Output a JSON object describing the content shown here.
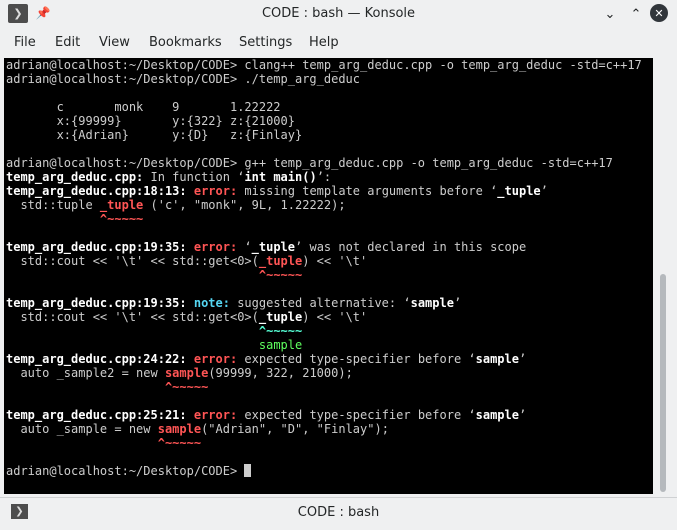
{
  "window": {
    "title": "CODE : bash — Konsole",
    "app_menu_icon": "terminal-icon",
    "pin_icon": "pin-icon",
    "buttons": {
      "minimize": "⌄",
      "maximize": "⌃",
      "close": "✕"
    }
  },
  "menubar": [
    "File",
    "Edit",
    "View",
    "Bookmarks",
    "Settings",
    "Help"
  ],
  "terminal": {
    "cursor_visible": true,
    "lines": [
      [
        {
          "t": "adrian@localhost:~/Desktop/CODE> clang++ temp_arg_deduc.cpp -o temp_arg_deduc -std=c++17"
        }
      ],
      [
        {
          "t": "adrian@localhost:~/Desktop/CODE> ./temp_arg_deduc"
        }
      ],
      [
        {
          "t": ""
        }
      ],
      [
        {
          "t": "       c       monk    9       1.22222"
        }
      ],
      [
        {
          "t": "       x:{99999}       y:{322} z:{21000}"
        }
      ],
      [
        {
          "t": "       x:{Adrian}      y:{D}   z:{Finlay}"
        }
      ],
      [
        {
          "t": ""
        }
      ],
      [
        {
          "t": "adrian@localhost:~/Desktop/CODE> g++ temp_arg_deduc.cpp -o temp_arg_deduc -std=c++17"
        }
      ],
      [
        {
          "t": "temp_arg_deduc.cpp:",
          "c": "b"
        },
        {
          "t": " In function "
        },
        {
          "t": "‘"
        },
        {
          "t": "int main()",
          "c": "b"
        },
        {
          "t": "’:"
        }
      ],
      [
        {
          "t": "temp_arg_deduc.cpp:18:13: ",
          "c": "b"
        },
        {
          "t": "error:",
          "c": "err"
        },
        {
          "t": " missing template arguments before ‘"
        },
        {
          "t": "_tuple",
          "c": "b"
        },
        {
          "t": "’"
        }
      ],
      [
        {
          "t": "  std::tuple "
        },
        {
          "t": "_tuple",
          "c": "hl-red"
        },
        {
          "t": " ('c', \"monk\", 9L, 1.22222);"
        }
      ],
      [
        {
          "t": "             "
        },
        {
          "t": "^~~~~~",
          "c": "caret-red"
        }
      ],
      [
        {
          "t": ""
        }
      ],
      [
        {
          "t": "temp_arg_deduc.cpp:19:35: ",
          "c": "b"
        },
        {
          "t": "error:",
          "c": "err"
        },
        {
          "t": " ‘"
        },
        {
          "t": "_tuple",
          "c": "b"
        },
        {
          "t": "’ was not declared in this scope"
        }
      ],
      [
        {
          "t": "  std::cout << '\\t' << std::get<0>("
        },
        {
          "t": "_tuple",
          "c": "hl-red"
        },
        {
          "t": ") << '\\t'"
        }
      ],
      [
        {
          "t": "                                   "
        },
        {
          "t": "^~~~~~",
          "c": "caret-red"
        }
      ],
      [
        {
          "t": ""
        }
      ],
      [
        {
          "t": "temp_arg_deduc.cpp:19:35: ",
          "c": "b"
        },
        {
          "t": "note:",
          "c": "note"
        },
        {
          "t": " suggested alternative: ‘"
        },
        {
          "t": "sample",
          "c": "b"
        },
        {
          "t": "’"
        }
      ],
      [
        {
          "t": "  std::cout << '\\t' << std::get<0>("
        },
        {
          "t": "_tuple",
          "c": "b"
        },
        {
          "t": ") << '\\t'"
        }
      ],
      [
        {
          "t": "                                   "
        },
        {
          "t": "^~~~~~",
          "c": "caret-green"
        }
      ],
      [
        {
          "t": "                                   "
        },
        {
          "t": "sample",
          "c": "hl-green"
        }
      ],
      [
        {
          "t": "temp_arg_deduc.cpp:24:22: ",
          "c": "b"
        },
        {
          "t": "error:",
          "c": "err"
        },
        {
          "t": " expected type-specifier before ‘"
        },
        {
          "t": "sample",
          "c": "b"
        },
        {
          "t": "’"
        }
      ],
      [
        {
          "t": "  auto _sample2 = new "
        },
        {
          "t": "sample",
          "c": "hl-red"
        },
        {
          "t": "(99999, 322, 21000);"
        }
      ],
      [
        {
          "t": "                      "
        },
        {
          "t": "^~~~~~",
          "c": "caret-red"
        }
      ],
      [
        {
          "t": ""
        }
      ],
      [
        {
          "t": "temp_arg_deduc.cpp:25:21: ",
          "c": "b"
        },
        {
          "t": "error:",
          "c": "err"
        },
        {
          "t": " expected type-specifier before ‘"
        },
        {
          "t": "sample",
          "c": "b"
        },
        {
          "t": "’"
        }
      ],
      [
        {
          "t": "  auto _sample = new "
        },
        {
          "t": "sample",
          "c": "hl-red"
        },
        {
          "t": "(\"Adrian\", \"D\", \"Finlay\");"
        }
      ],
      [
        {
          "t": "                     "
        },
        {
          "t": "^~~~~~",
          "c": "caret-red"
        }
      ],
      [
        {
          "t": ""
        }
      ],
      [
        {
          "t": "adrian@localhost:~/Desktop/CODE> "
        },
        {
          "cursor": true
        }
      ]
    ]
  },
  "tabbar": {
    "icon": "terminal-icon",
    "label": "CODE : bash"
  }
}
